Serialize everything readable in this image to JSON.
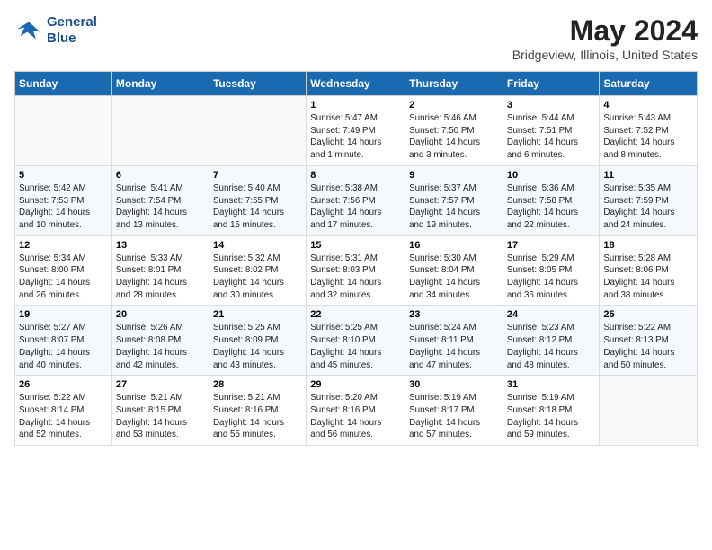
{
  "header": {
    "logo_line1": "General",
    "logo_line2": "Blue",
    "title": "May 2024",
    "subtitle": "Bridgeview, Illinois, United States"
  },
  "days_of_week": [
    "Sunday",
    "Monday",
    "Tuesday",
    "Wednesday",
    "Thursday",
    "Friday",
    "Saturday"
  ],
  "weeks": [
    [
      {
        "day": "",
        "info": ""
      },
      {
        "day": "",
        "info": ""
      },
      {
        "day": "",
        "info": ""
      },
      {
        "day": "1",
        "info": "Sunrise: 5:47 AM\nSunset: 7:49 PM\nDaylight: 14 hours\nand 1 minute."
      },
      {
        "day": "2",
        "info": "Sunrise: 5:46 AM\nSunset: 7:50 PM\nDaylight: 14 hours\nand 3 minutes."
      },
      {
        "day": "3",
        "info": "Sunrise: 5:44 AM\nSunset: 7:51 PM\nDaylight: 14 hours\nand 6 minutes."
      },
      {
        "day": "4",
        "info": "Sunrise: 5:43 AM\nSunset: 7:52 PM\nDaylight: 14 hours\nand 8 minutes."
      }
    ],
    [
      {
        "day": "5",
        "info": "Sunrise: 5:42 AM\nSunset: 7:53 PM\nDaylight: 14 hours\nand 10 minutes."
      },
      {
        "day": "6",
        "info": "Sunrise: 5:41 AM\nSunset: 7:54 PM\nDaylight: 14 hours\nand 13 minutes."
      },
      {
        "day": "7",
        "info": "Sunrise: 5:40 AM\nSunset: 7:55 PM\nDaylight: 14 hours\nand 15 minutes."
      },
      {
        "day": "8",
        "info": "Sunrise: 5:38 AM\nSunset: 7:56 PM\nDaylight: 14 hours\nand 17 minutes."
      },
      {
        "day": "9",
        "info": "Sunrise: 5:37 AM\nSunset: 7:57 PM\nDaylight: 14 hours\nand 19 minutes."
      },
      {
        "day": "10",
        "info": "Sunrise: 5:36 AM\nSunset: 7:58 PM\nDaylight: 14 hours\nand 22 minutes."
      },
      {
        "day": "11",
        "info": "Sunrise: 5:35 AM\nSunset: 7:59 PM\nDaylight: 14 hours\nand 24 minutes."
      }
    ],
    [
      {
        "day": "12",
        "info": "Sunrise: 5:34 AM\nSunset: 8:00 PM\nDaylight: 14 hours\nand 26 minutes."
      },
      {
        "day": "13",
        "info": "Sunrise: 5:33 AM\nSunset: 8:01 PM\nDaylight: 14 hours\nand 28 minutes."
      },
      {
        "day": "14",
        "info": "Sunrise: 5:32 AM\nSunset: 8:02 PM\nDaylight: 14 hours\nand 30 minutes."
      },
      {
        "day": "15",
        "info": "Sunrise: 5:31 AM\nSunset: 8:03 PM\nDaylight: 14 hours\nand 32 minutes."
      },
      {
        "day": "16",
        "info": "Sunrise: 5:30 AM\nSunset: 8:04 PM\nDaylight: 14 hours\nand 34 minutes."
      },
      {
        "day": "17",
        "info": "Sunrise: 5:29 AM\nSunset: 8:05 PM\nDaylight: 14 hours\nand 36 minutes."
      },
      {
        "day": "18",
        "info": "Sunrise: 5:28 AM\nSunset: 8:06 PM\nDaylight: 14 hours\nand 38 minutes."
      }
    ],
    [
      {
        "day": "19",
        "info": "Sunrise: 5:27 AM\nSunset: 8:07 PM\nDaylight: 14 hours\nand 40 minutes."
      },
      {
        "day": "20",
        "info": "Sunrise: 5:26 AM\nSunset: 8:08 PM\nDaylight: 14 hours\nand 42 minutes."
      },
      {
        "day": "21",
        "info": "Sunrise: 5:25 AM\nSunset: 8:09 PM\nDaylight: 14 hours\nand 43 minutes."
      },
      {
        "day": "22",
        "info": "Sunrise: 5:25 AM\nSunset: 8:10 PM\nDaylight: 14 hours\nand 45 minutes."
      },
      {
        "day": "23",
        "info": "Sunrise: 5:24 AM\nSunset: 8:11 PM\nDaylight: 14 hours\nand 47 minutes."
      },
      {
        "day": "24",
        "info": "Sunrise: 5:23 AM\nSunset: 8:12 PM\nDaylight: 14 hours\nand 48 minutes."
      },
      {
        "day": "25",
        "info": "Sunrise: 5:22 AM\nSunset: 8:13 PM\nDaylight: 14 hours\nand 50 minutes."
      }
    ],
    [
      {
        "day": "26",
        "info": "Sunrise: 5:22 AM\nSunset: 8:14 PM\nDaylight: 14 hours\nand 52 minutes."
      },
      {
        "day": "27",
        "info": "Sunrise: 5:21 AM\nSunset: 8:15 PM\nDaylight: 14 hours\nand 53 minutes."
      },
      {
        "day": "28",
        "info": "Sunrise: 5:21 AM\nSunset: 8:16 PM\nDaylight: 14 hours\nand 55 minutes."
      },
      {
        "day": "29",
        "info": "Sunrise: 5:20 AM\nSunset: 8:16 PM\nDaylight: 14 hours\nand 56 minutes."
      },
      {
        "day": "30",
        "info": "Sunrise: 5:19 AM\nSunset: 8:17 PM\nDaylight: 14 hours\nand 57 minutes."
      },
      {
        "day": "31",
        "info": "Sunrise: 5:19 AM\nSunset: 8:18 PM\nDaylight: 14 hours\nand 59 minutes."
      },
      {
        "day": "",
        "info": ""
      }
    ]
  ]
}
